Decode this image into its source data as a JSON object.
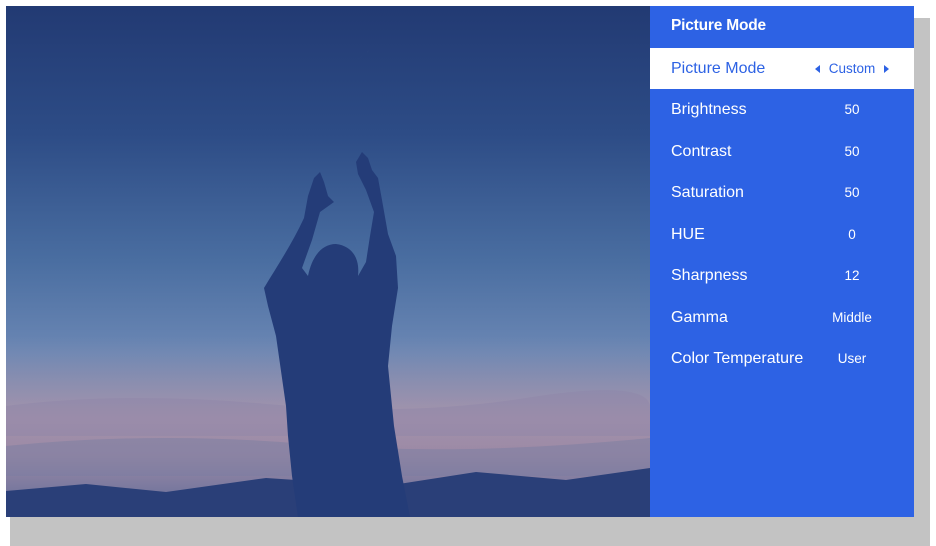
{
  "panel": {
    "title": "Picture Mode"
  },
  "menu": {
    "items": [
      {
        "label": "Picture Mode",
        "value": "Custom"
      },
      {
        "label": "Brightness",
        "value": "50"
      },
      {
        "label": "Contrast",
        "value": "50"
      },
      {
        "label": "Saturation",
        "value": "50"
      },
      {
        "label": "HUE",
        "value": "0"
      },
      {
        "label": "Sharpness",
        "value": "12"
      },
      {
        "label": "Gamma",
        "value": "Middle"
      },
      {
        "label": "Color Temperature",
        "value": "User"
      }
    ]
  },
  "icons": {
    "prev": "chevron-left-icon",
    "next": "chevron-right-icon"
  },
  "colors": {
    "panel_bg": "#2d62e4",
    "selected_bg": "#ffffff",
    "text": "#ffffff"
  }
}
